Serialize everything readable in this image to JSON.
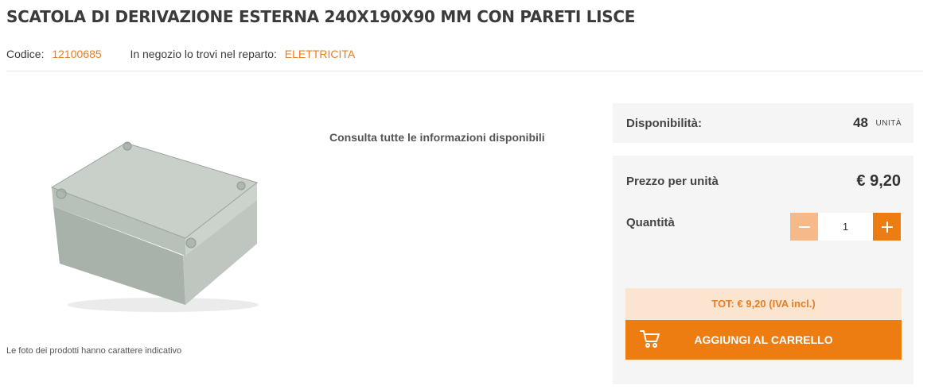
{
  "product": {
    "title": "SCATOLA DI DERIVAZIONE ESTERNA 240X190X90 MM CON PARETI LISCE",
    "code_label": "Codice:",
    "code_value": "12100685",
    "department_label": "In negozio lo trovi nel reparto:",
    "department_value": "ELETTRICITA",
    "photo_note": "Le foto dei prodotti hanno carattere indicativo",
    "info_link": "Consulta tutte le informazioni disponibili"
  },
  "availability": {
    "label": "Disponibilità:",
    "count": "48",
    "unit": "UNITÀ"
  },
  "purchase": {
    "price_label": "Prezzo per unità",
    "price_value": "€ 9,20",
    "quantity_label": "Quantità",
    "quantity_value": "1",
    "total": "TOT: € 9,20 (IVA incl.)",
    "add_to_cart_label": "AGGIUNGI AL CARRELLO"
  },
  "colors": {
    "accent": "#ee7d11",
    "accent_light": "#f5b98a",
    "total_bg": "#fbe5d1",
    "panel_bg": "#f5f5f5"
  },
  "icons": {
    "minus": "minus-icon",
    "plus": "plus-icon",
    "cart": "cart-icon"
  }
}
